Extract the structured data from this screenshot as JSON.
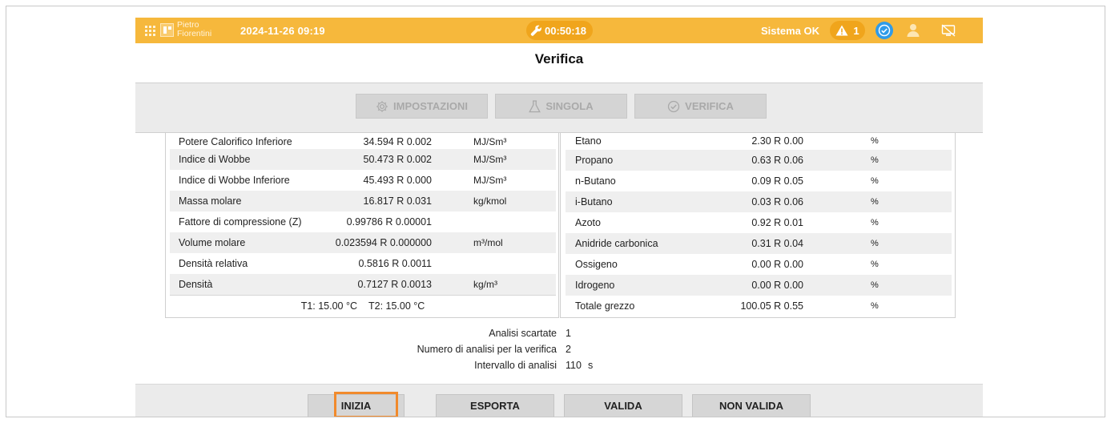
{
  "header": {
    "logo_line1": "Pietro",
    "logo_line2": "Fiorentini",
    "datetime": "2024-11-26 09:19",
    "timer": "00:50:18",
    "system_status": "Sistema OK",
    "warning_count": "1",
    "colors": {
      "bar": "#f6b83c",
      "pill": "#f0a51c",
      "check": "#2f9be8"
    }
  },
  "page": {
    "title": "Verifica"
  },
  "tabs": [
    {
      "label": "IMPOSTAZIONI",
      "icon": "gear-icon"
    },
    {
      "label": "SINGOLA",
      "icon": "flask-icon"
    },
    {
      "label": "VERIFICA",
      "icon": "check-circle-icon"
    }
  ],
  "left_table": {
    "rows": [
      {
        "name": "Potere Calorifico Inferiore",
        "value": "34.594 R 0.002",
        "unit": "MJ/Sm³"
      },
      {
        "name": "Indice di Wobbe",
        "value": "50.473 R 0.002",
        "unit": "MJ/Sm³"
      },
      {
        "name": "Indice di Wobbe Inferiore",
        "value": "45.493 R 0.000",
        "unit": "MJ/Sm³"
      },
      {
        "name": "Massa molare",
        "value": "16.817 R 0.031",
        "unit": "kg/kmol"
      },
      {
        "name": "Fattore di compressione (Z)",
        "value": "0.99786 R 0.00001",
        "unit": ""
      },
      {
        "name": "Volume molare",
        "value": "0.023594 R 0.000000",
        "unit": "m³/mol"
      },
      {
        "name": "Densità relativa",
        "value": "0.5816 R 0.0011",
        "unit": ""
      },
      {
        "name": "Densità",
        "value": "0.7127 R 0.0013",
        "unit": "kg/m³"
      }
    ],
    "t1": "T1: 15.00 °C",
    "t2": "T2: 15.00 °C"
  },
  "right_table": {
    "rows": [
      {
        "name": "Etano",
        "value": "2.30 R 0.00",
        "unit": "%"
      },
      {
        "name": "Propano",
        "value": "0.63 R 0.06",
        "unit": "%"
      },
      {
        "name": "n-Butano",
        "value": "0.09 R 0.05",
        "unit": "%"
      },
      {
        "name": "i-Butano",
        "value": "0.03 R 0.06",
        "unit": "%"
      },
      {
        "name": "Azoto",
        "value": "0.92 R 0.01",
        "unit": "%"
      },
      {
        "name": "Anidride carbonica",
        "value": "0.31 R 0.04",
        "unit": "%"
      },
      {
        "name": "Ossigeno",
        "value": "0.00 R 0.00",
        "unit": "%"
      },
      {
        "name": "Idrogeno",
        "value": "0.00 R 0.00",
        "unit": "%"
      },
      {
        "name": "Totale grezzo",
        "value": "100.05 R 0.55",
        "unit": "%"
      }
    ]
  },
  "summary": [
    {
      "label": "Analisi scartate",
      "value": "1",
      "unit": ""
    },
    {
      "label": "Numero di analisi per la verifica",
      "value": "2",
      "unit": ""
    },
    {
      "label": "Intervallo di analisi",
      "value": "110",
      "unit": "s"
    }
  ],
  "footer": {
    "inizia": "INIZIA",
    "esporta": "ESPORTA",
    "valida": "VALIDA",
    "non_valida": "NON VALIDA",
    "focus_color": "#f18a2c"
  }
}
